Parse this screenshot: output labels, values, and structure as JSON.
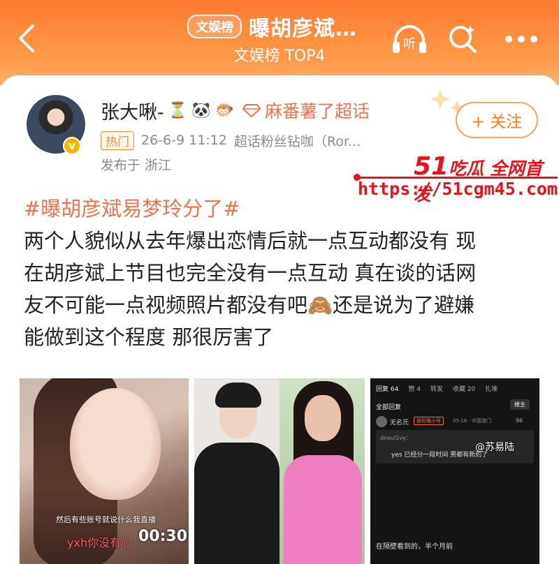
{
  "header": {
    "tag": "文娱榜",
    "title": "曝胡彦斌…",
    "subtitle": "文娱榜 TOP4",
    "listen_label": "听"
  },
  "post": {
    "username": "张大啾-",
    "emojis": [
      "⏳",
      "🐼",
      "🐡"
    ],
    "topic": "麻番薯了超话",
    "hot_tag": "热门",
    "time": "26-6-9 11:12",
    "source": "超话粉丝钻咖（Ror...",
    "location": "发布于 浙江",
    "follow_label": "+ 关注",
    "hashtag": "#曝胡彦斌易梦玲分了#",
    "lines": [
      "两个人貌似从去年爆出恋情后就一点互动都没有 现",
      "在胡彦斌上节目也完全没有一点互动 真在谈的话网",
      "友不可能一点视频照片都没有吧🙈还是说为了避嫌",
      "能做到这个程度 那很厉害了"
    ]
  },
  "watermark": {
    "prefix": "51",
    "line1": "吃瓜 全网首发",
    "line2": "https://51cgm45.com"
  },
  "images": {
    "img1": {
      "subtitle1": "然后有些账号就说什么我直播",
      "subtitle2": "yxh你没有心",
      "timer": "00:30"
    },
    "img3": {
      "tabs": [
        "回复 64",
        "赞 4",
        "转发",
        "收藏 20",
        "扎堆"
      ],
      "all_replies": "全部回复",
      "floor": "楼主",
      "commenter": "无名氏",
      "badge": "旅形植小号",
      "date": "05-18 · 中国澳门",
      "likes": "96",
      "reply_user": "dnoul1vy：",
      "reply_text": "yes 已经分一段时间 男都有新的了",
      "watermark": "@苏易陆",
      "bottom": "在隔壁看到的，半个月前"
    }
  }
}
